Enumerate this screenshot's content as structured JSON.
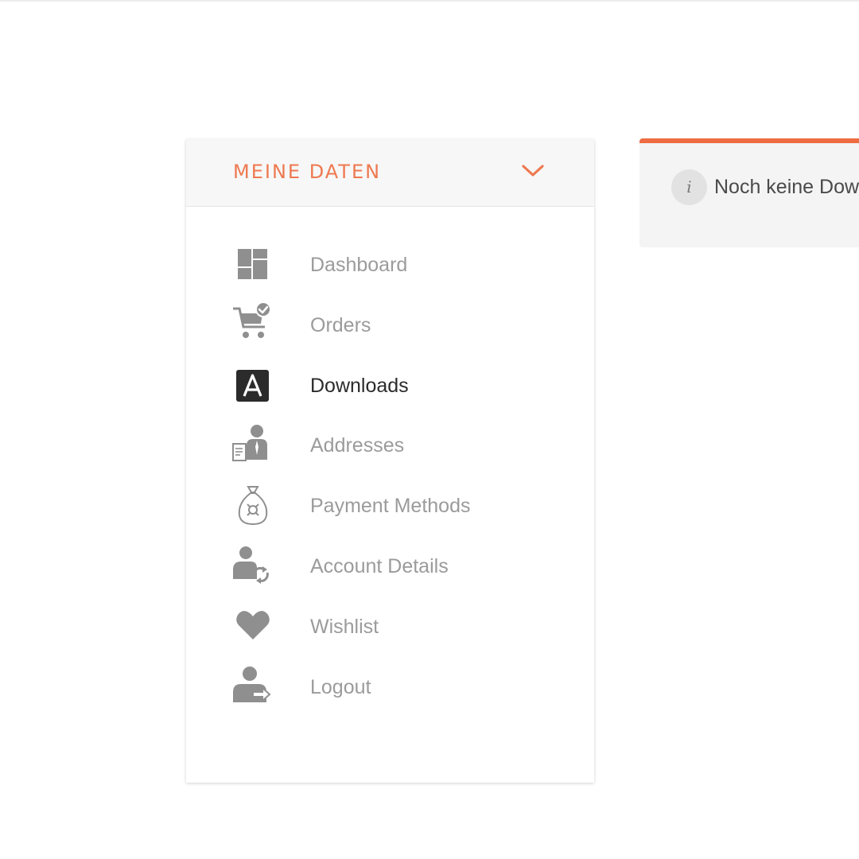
{
  "account_nav": {
    "title": "MEINE DATEN",
    "toggle_icon": "chevron-down-icon",
    "items": [
      {
        "label": "Dashboard",
        "icon": "dashboard-icon",
        "active": false
      },
      {
        "label": "Orders",
        "icon": "cart-check-icon",
        "active": false
      },
      {
        "label": "Downloads",
        "icon": "download-a-icon",
        "active": true
      },
      {
        "label": "Addresses",
        "icon": "address-person-icon",
        "active": false
      },
      {
        "label": "Payment Methods",
        "icon": "money-bag-icon",
        "active": false
      },
      {
        "label": "Account Details",
        "icon": "user-sync-icon",
        "active": false
      },
      {
        "label": "Wishlist",
        "icon": "heart-icon",
        "active": false
      },
      {
        "label": "Logout",
        "icon": "user-logout-icon",
        "active": false
      }
    ]
  },
  "notice": {
    "icon": "info-icon",
    "icon_glyph": "i",
    "text": "Noch keine Dow"
  },
  "colors": {
    "accent": "#ee7950",
    "notice_border": "#ee6c41",
    "text_muted": "#9b9b9b",
    "text_active": "#2b2b2b",
    "header_bg": "#f7f7f7",
    "notice_bg": "#f4f4f4"
  }
}
